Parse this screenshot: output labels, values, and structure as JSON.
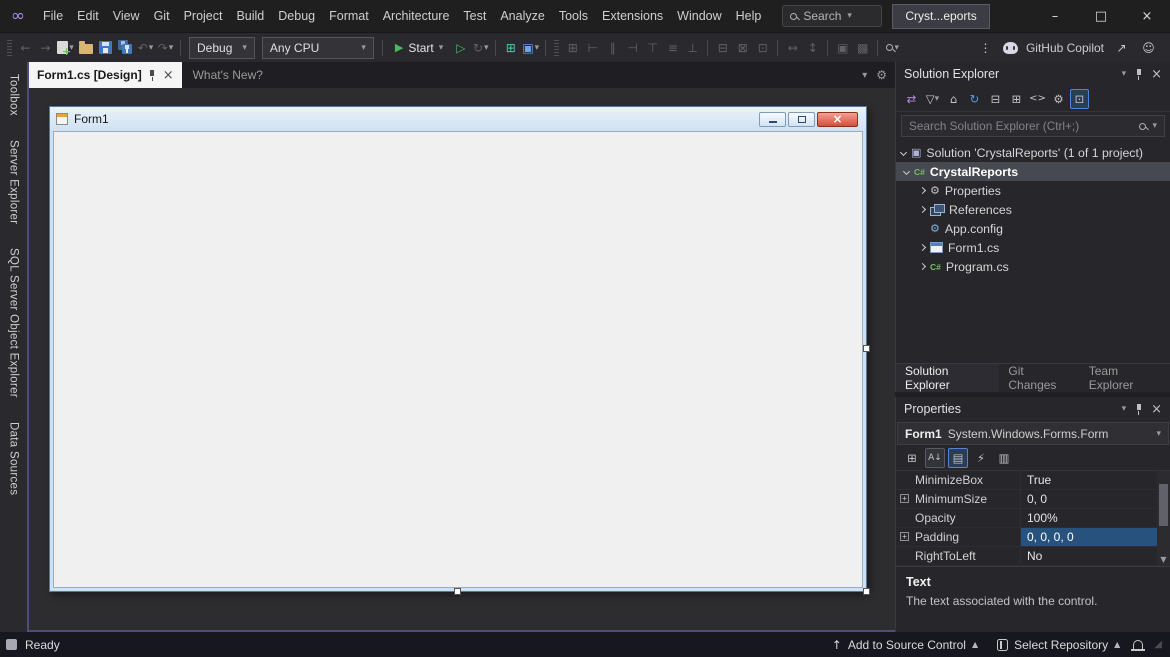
{
  "colors": {
    "accent_focus_border": "#4c4c80",
    "selection_blue": "#28527e",
    "start_green": "#4bb860",
    "form_close_red": "#d4503a",
    "active_tab_bg": "#f5f5f5",
    "tree_selection_gray": "#46494f"
  },
  "titlebar": {
    "menus": [
      "File",
      "Edit",
      "View",
      "Git",
      "Project",
      "Build",
      "Debug",
      "Format",
      "Architecture",
      "Test",
      "Analyze",
      "Tools",
      "Extensions",
      "Window",
      "Help"
    ],
    "search_label": "Search",
    "window_title": "Cryst...eports"
  },
  "toolbar": {
    "config_combo": "Debug",
    "platform_combo": "Any CPU",
    "start_label": "Start",
    "copilot_label": "GitHub Copilot"
  },
  "left_rail": {
    "tabs": [
      "Toolbox",
      "Server Explorer",
      "SQL Server Object Explorer",
      "Data Sources"
    ]
  },
  "doc_tabs": {
    "active_tab": "Form1.cs [Design]",
    "whats_new_tab": "What's New?"
  },
  "designer": {
    "form_title": "Form1"
  },
  "solution_explorer": {
    "title": "Solution Explorer",
    "search_placeholder": "Search Solution Explorer (Ctrl+;)",
    "items": {
      "solution": "Solution 'CrystalReports' (1 of 1 project)",
      "project": "CrystalReports",
      "properties": "Properties",
      "references": "References",
      "app_config": "App.config",
      "form1": "Form1.cs",
      "program": "Program.cs"
    },
    "tabs": [
      "Solution Explorer",
      "Git Changes",
      "Team Explorer"
    ]
  },
  "properties_panel": {
    "title": "Properties",
    "object_name": "Form1",
    "object_type": "System.Windows.Forms.Form",
    "rows": [
      {
        "name": "MinimizeBox",
        "value": "True"
      },
      {
        "name": "MinimumSize",
        "value": "0, 0"
      },
      {
        "name": "Opacity",
        "value": "100%"
      },
      {
        "name": "Padding",
        "value": "0, 0, 0, 0"
      },
      {
        "name": "RightToLeft",
        "value": "No"
      }
    ],
    "description_title": "Text",
    "description_body": "The text associated with the control."
  },
  "status_bar": {
    "ready": "Ready",
    "add_to_source_control": "Add to Source Control",
    "select_repository": "Select Repository"
  }
}
